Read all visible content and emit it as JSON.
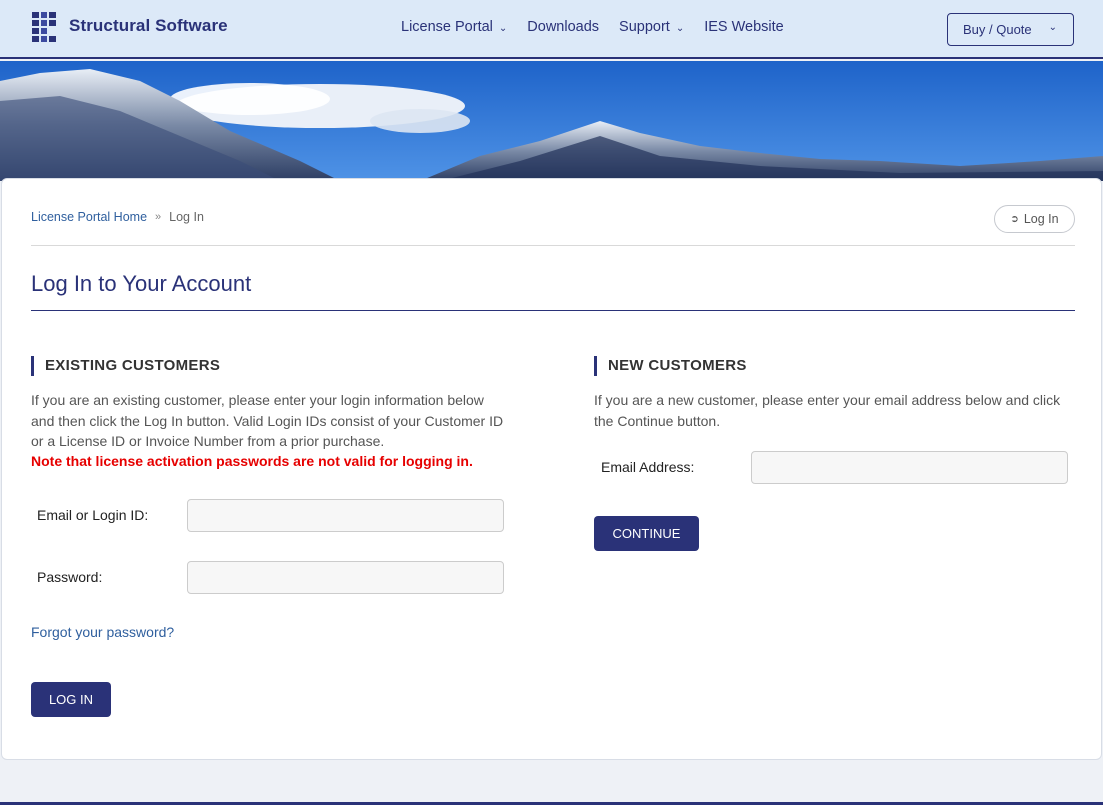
{
  "header": {
    "brand": "Structural Software",
    "nav": [
      {
        "label": "License Portal",
        "has_dropdown": true
      },
      {
        "label": "Downloads",
        "has_dropdown": false
      },
      {
        "label": "Support",
        "has_dropdown": true
      },
      {
        "label": "IES Website",
        "has_dropdown": false
      }
    ],
    "buy_quote": "Buy / Quote"
  },
  "breadcrumb": {
    "home": "License Portal Home",
    "separator": "»",
    "current": "Log In"
  },
  "login_pill": "Log In",
  "page_title": "Log In to Your Account",
  "existing": {
    "heading": "EXISTING CUSTOMERS",
    "description": "If you are an existing customer, please enter your login information below and then click the Log In button. Valid Login IDs consist of your Customer ID or a License ID or Invoice Number from a prior purchase.",
    "warning": "Note that license activation passwords are not valid for logging in.",
    "login_label": "Email or Login ID:",
    "login_value": "",
    "password_label": "Password:",
    "password_value": "",
    "forgot": "Forgot your password?",
    "button": "LOG IN"
  },
  "new_customers": {
    "heading": "NEW CUSTOMERS",
    "description": "If you are a new customer, please enter your email address below and click the Continue button.",
    "email_label": "Email Address:",
    "email_value": "",
    "button": "CONTINUE"
  },
  "colors": {
    "primary": "#2a3278",
    "header_bg": "#dce9f8",
    "link": "#2f5f9e",
    "warning": "#e60000"
  }
}
